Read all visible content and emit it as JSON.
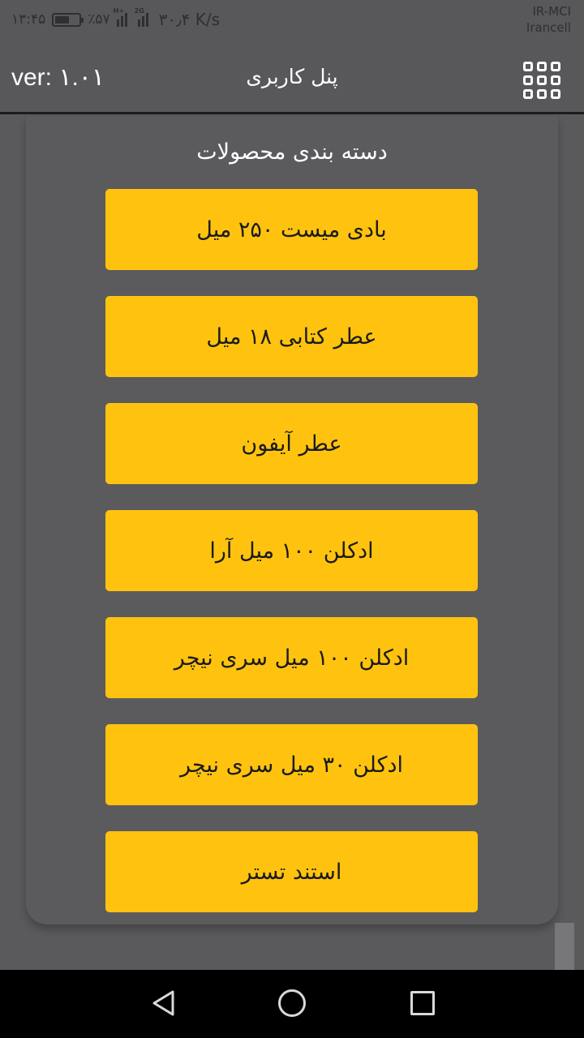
{
  "status_bar": {
    "time": "۱۳:۴۵",
    "battery": "٪۵۷",
    "net_tag_1": "H+",
    "net_tag_2": "2G",
    "speed": "۳۰٫۴ K/s",
    "carrier_1": "IR-MCI",
    "carrier_2": "Irancell"
  },
  "app_bar": {
    "version": "ver: ۱.۰۱",
    "title": "پنل کاربری",
    "menu_icon": "grid-menu-icon"
  },
  "content": {
    "section_title": "دسته بندی محصولات",
    "categories": [
      "بادی میست ۲۵۰ میل",
      "عطر کتابی ۱۸ میل",
      "عطر آیفون",
      "ادکلن ۱۰۰ میل آرا",
      "ادکلن ۱۰۰ میل سری نیچر",
      "ادکلن ۳۰ میل سری نیچر",
      "استند تستر"
    ]
  },
  "nav_bar": {
    "back_icon": "triangle-back-icon",
    "home_icon": "circle-home-icon",
    "recents_icon": "square-recents-icon"
  },
  "colors": {
    "background": "#5a5a5d",
    "accent_button": "#ffc30f",
    "button_text": "#1b1b1b",
    "header_text": "#ffffff"
  }
}
